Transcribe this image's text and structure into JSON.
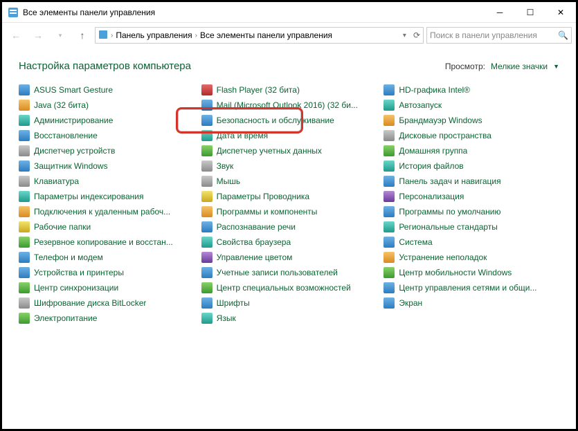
{
  "window": {
    "title": "Все элементы панели управления"
  },
  "nav": {
    "crumb1": "Панель управления",
    "crumb2": "Все элементы панели управления",
    "search_placeholder": "Поиск в панели управления"
  },
  "page": {
    "title": "Настройка параметров компьютера",
    "view_label": "Просмотр:",
    "view_value": "Мелкие значки"
  },
  "items": {
    "col1": [
      {
        "label": "ASUS Smart Gesture",
        "ic": "ic-blue"
      },
      {
        "label": "Java (32 бита)",
        "ic": "ic-orange"
      },
      {
        "label": "Администрирование",
        "ic": "ic-teal"
      },
      {
        "label": "Восстановление",
        "ic": "ic-blue"
      },
      {
        "label": "Диспетчер устройств",
        "ic": "ic-gray"
      },
      {
        "label": "Защитник Windows",
        "ic": "ic-blue"
      },
      {
        "label": "Клавиатура",
        "ic": "ic-gray"
      },
      {
        "label": "Параметры индексирования",
        "ic": "ic-teal"
      },
      {
        "label": "Подключения к удаленным рабоч...",
        "ic": "ic-orange"
      },
      {
        "label": "Рабочие папки",
        "ic": "ic-yellow"
      },
      {
        "label": "Резервное копирование и восстан...",
        "ic": "ic-green"
      },
      {
        "label": "Телефон и модем",
        "ic": "ic-blue"
      },
      {
        "label": "Устройства и принтеры",
        "ic": "ic-blue"
      },
      {
        "label": "Центр синхронизации",
        "ic": "ic-green"
      },
      {
        "label": "Шифрование диска BitLocker",
        "ic": "ic-gray"
      },
      {
        "label": "Электропитание",
        "ic": "ic-green"
      }
    ],
    "col2": [
      {
        "label": "Flash Player (32 бита)",
        "ic": "ic-red",
        "highlight": true
      },
      {
        "label": "Mail (Microsoft Outlook 2016) (32 би...",
        "ic": "ic-blue"
      },
      {
        "label": "Безопасность и обслуживание",
        "ic": "ic-blue"
      },
      {
        "label": "Дата и время",
        "ic": "ic-teal"
      },
      {
        "label": "Диспетчер учетных данных",
        "ic": "ic-green"
      },
      {
        "label": "Звук",
        "ic": "ic-gray"
      },
      {
        "label": "Мышь",
        "ic": "ic-gray"
      },
      {
        "label": "Параметры Проводника",
        "ic": "ic-yellow"
      },
      {
        "label": "Программы и компоненты",
        "ic": "ic-orange"
      },
      {
        "label": "Распознавание речи",
        "ic": "ic-blue"
      },
      {
        "label": "Свойства браузера",
        "ic": "ic-teal"
      },
      {
        "label": "Управление цветом",
        "ic": "ic-purple"
      },
      {
        "label": "Учетные записи пользователей",
        "ic": "ic-blue"
      },
      {
        "label": "Центр специальных возможностей",
        "ic": "ic-green"
      },
      {
        "label": "Шрифты",
        "ic": "ic-blue"
      },
      {
        "label": "Язык",
        "ic": "ic-teal"
      }
    ],
    "col3": [
      {
        "label": "HD-графика Intel®",
        "ic": "ic-blue"
      },
      {
        "label": "Автозапуск",
        "ic": "ic-teal"
      },
      {
        "label": "Брандмауэр Windows",
        "ic": "ic-orange"
      },
      {
        "label": "Дисковые пространства",
        "ic": "ic-gray"
      },
      {
        "label": "Домашняя группа",
        "ic": "ic-green"
      },
      {
        "label": "История файлов",
        "ic": "ic-teal"
      },
      {
        "label": "Панель задач и навигация",
        "ic": "ic-blue"
      },
      {
        "label": "Персонализация",
        "ic": "ic-purple"
      },
      {
        "label": "Программы по умолчанию",
        "ic": "ic-blue"
      },
      {
        "label": "Региональные стандарты",
        "ic": "ic-teal"
      },
      {
        "label": "Система",
        "ic": "ic-blue"
      },
      {
        "label": "Устранение неполадок",
        "ic": "ic-orange"
      },
      {
        "label": "Центр мобильности Windows",
        "ic": "ic-green"
      },
      {
        "label": "Центр управления сетями и общи...",
        "ic": "ic-blue"
      },
      {
        "label": "Экран",
        "ic": "ic-blue"
      }
    ]
  }
}
